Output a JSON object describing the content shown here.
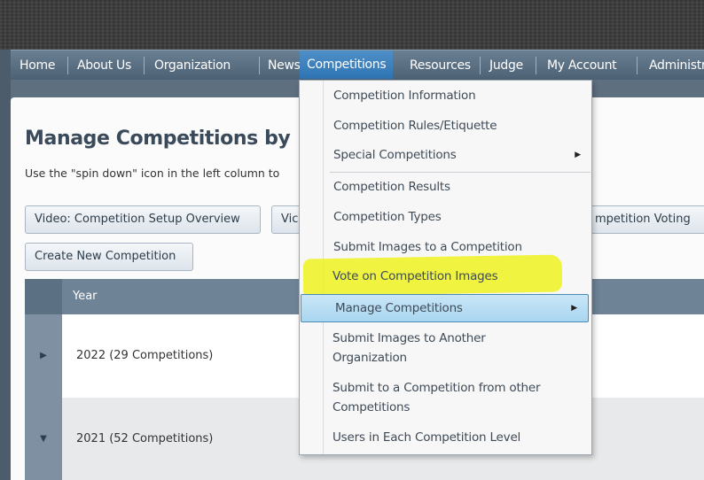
{
  "nav": {
    "items": [
      {
        "label": "Home"
      },
      {
        "label": "About Us"
      },
      {
        "label": "Organization"
      },
      {
        "label": "News"
      },
      {
        "label": "Competitions"
      },
      {
        "label": "Resources"
      },
      {
        "label": "Judge"
      },
      {
        "label": "My Account"
      },
      {
        "label": "Administra"
      }
    ],
    "active": "Competitions"
  },
  "page": {
    "title": "Manage Competitions by",
    "instructions": "Use the \"spin down\" icon in the left column to"
  },
  "buttons": {
    "video_setup": "Video: Competition Setup Overview",
    "video_partial": "Vic",
    "voting_partial": "mpetition Voting",
    "create_new": "Create New Competition"
  },
  "grid": {
    "header": "Year",
    "rows": [
      {
        "label": "2022 (29 Competitions)",
        "expanded": false
      },
      {
        "label": "2021 (52 Competitions)",
        "expanded": true
      }
    ]
  },
  "menu": {
    "items": [
      {
        "label": "Competition Information"
      },
      {
        "label": "Competition Rules/Etiquette"
      },
      {
        "label": "Special Competitions",
        "submenu": true
      },
      {
        "label": "Competition Results"
      },
      {
        "label": "Competition Types"
      },
      {
        "label": "Submit Images to a Competition"
      },
      {
        "label": "Vote on Competition Images",
        "highlighted": true
      },
      {
        "label": "Manage Competitions",
        "submenu": true,
        "selected": true
      },
      {
        "label": "Submit Images to Another Organization"
      },
      {
        "label": "Submit to a Competition from other Competitions"
      },
      {
        "label": "Users in Each Competition Level"
      }
    ]
  },
  "icons": {
    "submenu_arrow": "chevron-right-icon",
    "row_collapsed": "caret-right-icon",
    "row_expanded": "caret-down-icon"
  },
  "colors": {
    "nav_bar": "#5a6e82",
    "nav_active": "#3a7fbf",
    "menu_selected": "#b5dcf2",
    "highlight": "#eef21e",
    "grid_header": "#6f8396"
  }
}
